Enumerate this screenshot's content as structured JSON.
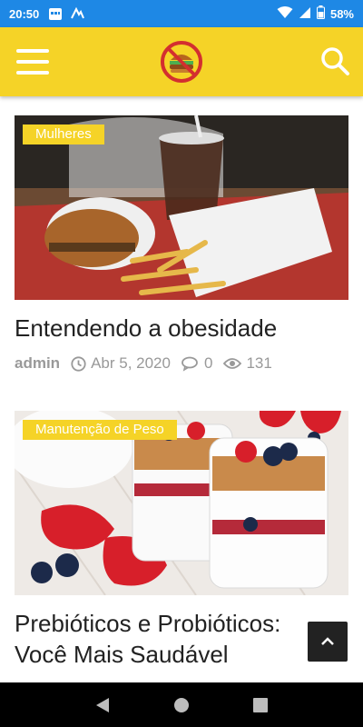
{
  "status_bar": {
    "time": "20:50",
    "battery": "58%",
    "icons": [
      "calendar-icon",
      "signal-app-icon",
      "wifi-icon",
      "cell-signal-icon",
      "battery-icon"
    ]
  },
  "header": {
    "icons": [
      "menu-icon",
      "logo",
      "search-icon"
    ],
    "brand_color": "#f5d327"
  },
  "posts": [
    {
      "category": "Mulheres",
      "title": "Entendendo a obesidade",
      "author": "admin",
      "date": "Abr 5, 2020",
      "comments": "0",
      "views": "131",
      "image": "burger-fries-drink-photo"
    },
    {
      "category": "Manutenção de Peso",
      "title_line1": "Prebióticos e Probióticos:",
      "title_line2": "Você Mais Saudável",
      "image": "yogurt-parfait-berries-photo"
    }
  ],
  "nav": {
    "icons": [
      "back-icon",
      "home-icon",
      "recents-icon"
    ]
  }
}
